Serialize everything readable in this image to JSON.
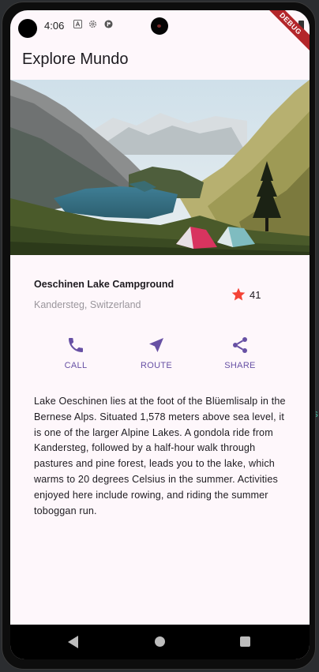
{
  "status_bar": {
    "time": "4:06",
    "icons": [
      "accessibility-icon",
      "gear-icon",
      "vpn-key-icon",
      "battery-icon"
    ]
  },
  "debug_banner": "DEBUG",
  "app_bar": {
    "title": "Explore Mundo"
  },
  "hero_image": {
    "subject": "mountain lake with tents"
  },
  "place": {
    "title": "Oeschinen Lake Campground",
    "location": "Kandersteg, Switzerland",
    "rating_count": "41",
    "star_color": "#f44336"
  },
  "actions": [
    {
      "label": "CALL",
      "icon": "phone-icon"
    },
    {
      "label": "ROUTE",
      "icon": "near-me-icon"
    },
    {
      "label": "SHARE",
      "icon": "share-icon"
    }
  ],
  "description": "Lake Oeschinen lies at the foot of the Blüemlisalp in the Bernese Alps. Situated 1,578 meters above sea level, it is one of the larger Alpine Lakes. A gondola ride from Kandersteg, followed by a half-hour walk through pastures and pine forest, leads you to the lake, which warms to 20 degrees Celsius in the summer. Activities enjoyed here include rowing, and riding the summer toboggan run.",
  "colors": {
    "accent": "#6750a4",
    "background": "#fef7fb"
  },
  "nav_bar": {
    "buttons": [
      "back-icon",
      "home-icon",
      "recents-icon"
    ]
  }
}
